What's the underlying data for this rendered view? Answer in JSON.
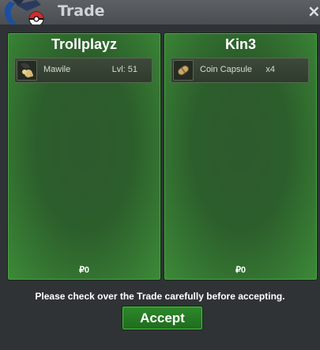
{
  "window": {
    "title": "Trade",
    "close_label": "×"
  },
  "trade": {
    "left": {
      "player_name": "Trollplayz",
      "item": {
        "name": "Mawile",
        "extra": "Lvl: 51",
        "icon": "mawile-icon"
      },
      "money": "₽0"
    },
    "right": {
      "player_name": "Kin3",
      "item": {
        "name": "Coin Capsule",
        "extra": "x4",
        "icon": "coin-capsule-icon"
      },
      "money": "₽0"
    }
  },
  "notice_text": "Please check over the Trade carefully before accepting.",
  "accept_label": "Accept",
  "colors": {
    "panel_green": "#2c5e2b",
    "panel_border": "#4da147",
    "titlebar": "#4a4e52",
    "accept_button": "#2d8a2a"
  }
}
